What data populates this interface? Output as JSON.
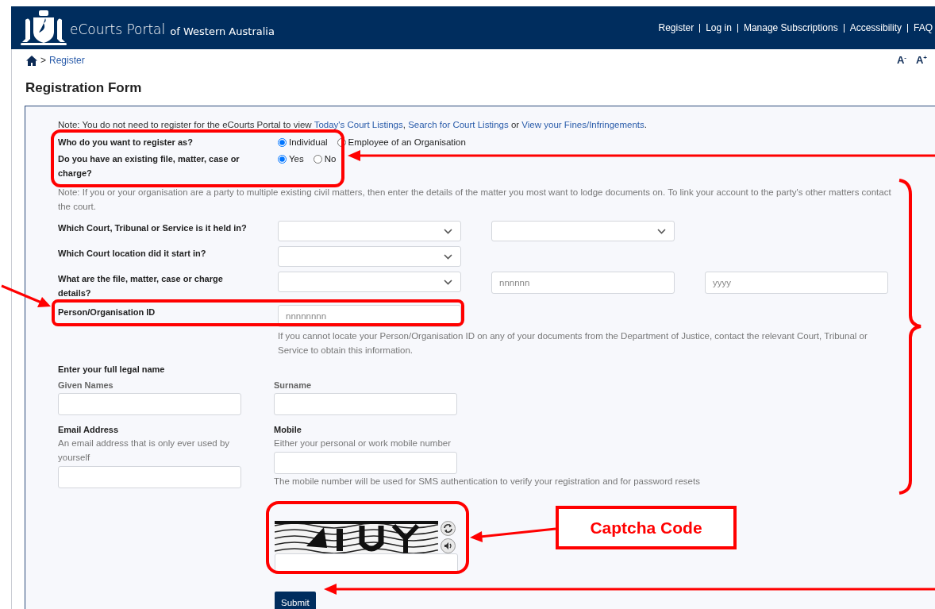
{
  "header": {
    "title": "eCourts Portal",
    "subtitle": "of Western Australia",
    "nav": [
      "Register",
      "Log in",
      "Manage Subscriptions",
      "Accessibility",
      "FAQ"
    ]
  },
  "breadcrumb": {
    "separator": ">",
    "current": "Register"
  },
  "font_size_controls": [
    "A$^{-}$",
    "A$^{+}$"
  ],
  "heading": "Registration Form",
  "note": {
    "text": "Note: You do not need to register for the eCourts Portal to view ",
    "links": [
      "Today's Court Listings",
      "Search for Court Listings",
      "View your Fines/Infringements"
    ],
    "joiners": [
      ", ",
      " or ",
      "."
    ]
  },
  "register_as": {
    "label": "Who do you want to register as?",
    "options": [
      {
        "label": "Individual",
        "selected": true
      },
      {
        "label": "Employee of an Organisation",
        "selected": false
      }
    ]
  },
  "existing_matter": {
    "label": "Do you have an existing file, matter, case or charge?",
    "options": [
      {
        "label": "Yes",
        "selected": true
      },
      {
        "label": "No",
        "selected": false
      }
    ]
  },
  "matter_note": "Note: If you or your organisation are a party to multiple existing civil matters, then enter the details of the matter you most want to lodge documents on. To link your account to the party's other matters contact the court.",
  "matter_rows": [
    {
      "label": "Which Court, Tribunal or Service is it held in?",
      "controls": [
        {
          "kind": "select"
        },
        {
          "kind": "select"
        }
      ]
    },
    {
      "label": "Which Court location did it start in?",
      "controls": [
        {
          "kind": "select"
        }
      ]
    },
    {
      "label": "What are the file, matter, case or charge details?",
      "controls": [
        {
          "kind": "select"
        },
        {
          "kind": "input",
          "placeholder": "nnnnnn"
        },
        {
          "kind": "input",
          "placeholder": "yyyy"
        }
      ]
    },
    {
      "label": "Person/Organisation ID",
      "controls": [
        {
          "kind": "input",
          "placeholder": "nnnnnnnn"
        }
      ]
    }
  ],
  "id_help": "If you cannot locate your Person/Organisation ID on any of your documents from the Department of Justice, contact the relevant Court, Tribunal or Service to obtain this information.",
  "name_heading": "Enter your full legal name",
  "name_fields": [
    {
      "label": "Given Names"
    },
    {
      "label": "Surname"
    }
  ],
  "email": {
    "label": "Email Address",
    "description": "An email address that is only ever used by yourself"
  },
  "mobile": {
    "label": "Mobile",
    "description": "Either your personal or work mobile number",
    "help": "The mobile number will be used for SMS authentication to verify your registration and for password resets"
  },
  "captcha": {
    "kind": "picture"
  },
  "submit": "Submit",
  "annotations": {
    "callout": "Captcha Code"
  }
}
